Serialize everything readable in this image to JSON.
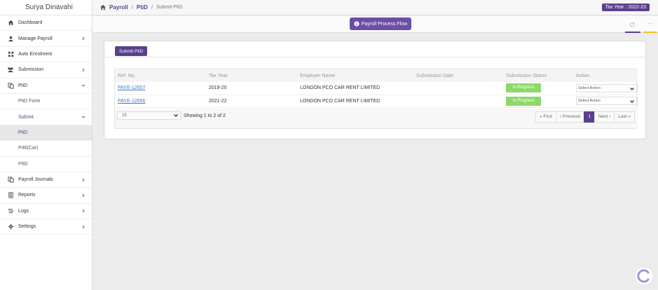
{
  "user": "Surya Dinavahi",
  "sidebar": {
    "items": [
      {
        "label": "Dashboard",
        "icon": "home-icon"
      },
      {
        "label": "Manage Payroll",
        "icon": "user-icon"
      },
      {
        "label": "Auto Enrolment",
        "icon": "grid-icon"
      },
      {
        "label": "Submission",
        "icon": "users-icon"
      },
      {
        "label": "PtiD",
        "icon": "copy-icon"
      },
      {
        "label": "PtiD Form"
      },
      {
        "label": "Submit"
      },
      {
        "label": "PtiD"
      },
      {
        "label": "P46(Car)"
      },
      {
        "label": "P9D"
      },
      {
        "label": "Payroll Journals",
        "icon": "copy-icon"
      },
      {
        "label": "Reports",
        "icon": "report-icon"
      },
      {
        "label": "Logs",
        "icon": "history-icon"
      },
      {
        "label": "Settings",
        "icon": "gear-icon"
      }
    ]
  },
  "breadcrumb": {
    "home": "Payroll",
    "level1": "PtiD",
    "level2": "Submit-PtiD"
  },
  "tax_year_badge": "Tax Year : 2022-23",
  "process_flow_label": "Payroll Process Flow",
  "card": {
    "submit_label": "Submit PtiD",
    "columns": [
      "Ref. No.",
      "Tax Year",
      "Employer Name",
      "Submission Date",
      "Submission Status",
      "Action"
    ],
    "rows": [
      {
        "ref": "PAYE-12657",
        "tax_year": "2019-20",
        "employer": "LONDON PCO CAR RENT LIMITED",
        "date": "",
        "status": "In Progress",
        "action": "Select Action"
      },
      {
        "ref": "PAYE-12656",
        "tax_year": "2021-22",
        "employer": "LONDON PCO CAR RENT LIMITED",
        "date": "",
        "status": "In Progress",
        "action": "Select Action"
      }
    ],
    "page_size": "15",
    "showing": "Showing 1 to 2 of 2",
    "pager": {
      "first": "« First",
      "previous": "‹ Previous",
      "current": "1",
      "next": "Next ›",
      "last": "Last »"
    }
  },
  "colors": {
    "brand": "#5b3f8e",
    "status": "#8ed86b",
    "accent_yellow": "#f3c322"
  }
}
